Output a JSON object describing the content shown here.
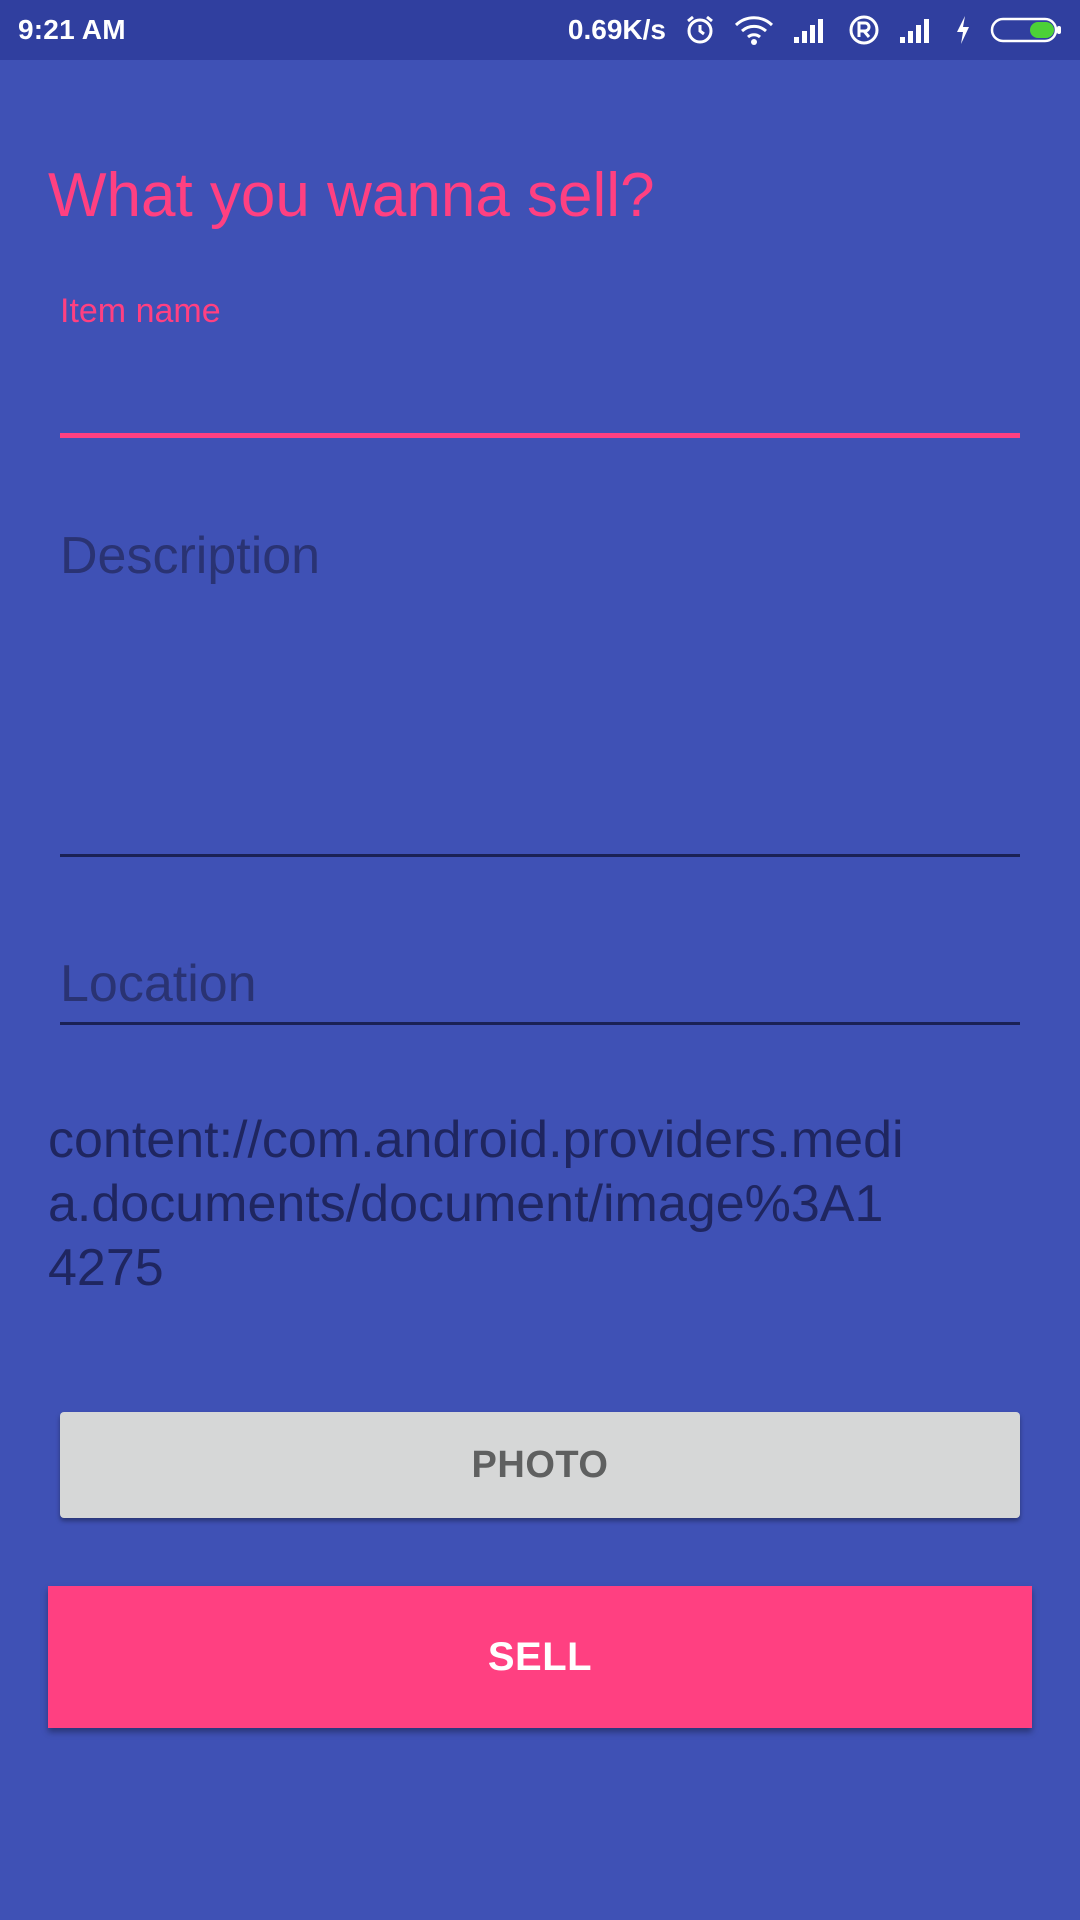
{
  "status_bar": {
    "time": "9:21 AM",
    "net_speed": "0.69K/s",
    "icons": [
      "alarm-icon",
      "wifi-icon",
      "signal-icon",
      "roaming-icon",
      "signal-icon",
      "charging-icon",
      "battery-icon"
    ]
  },
  "form": {
    "title": "What you wanna sell?",
    "item_name_label": "Item name",
    "item_name_value": "",
    "description_placeholder": "Description",
    "location_placeholder": "Location",
    "photo_uri": "content://com.android.providers.media.documents/document/image%3A14275",
    "photo_button_label": "PHOTO",
    "sell_button_label": "SELL"
  },
  "colors": {
    "background": "#3F51B5",
    "status_bar": "#303F9F",
    "accent": "#FF4081",
    "secondary_button": "#D6D7D7"
  }
}
